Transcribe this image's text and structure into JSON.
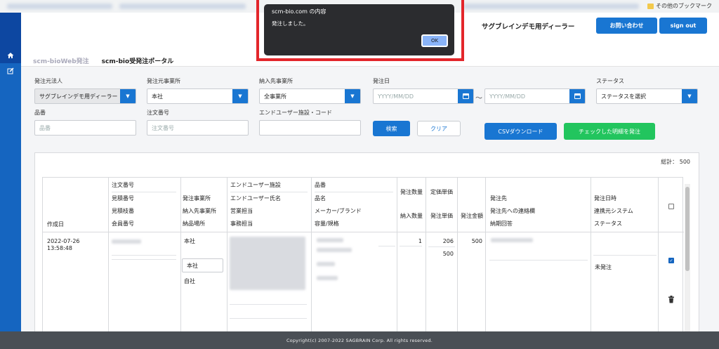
{
  "browser": {
    "bookmark_label": "その他のブックマーク"
  },
  "header": {
    "dealer_name": "サグブレインデモ用ディーラー",
    "contact_label": "お問い合わせ",
    "signout_label": "sign out"
  },
  "tabs": [
    "scm-bioWeb発注",
    "scm-bio受発注ポータル"
  ],
  "filters": {
    "hatchu_moto_hojin": {
      "label": "発注元法人",
      "value": "サグブレインデモ用ディーラー"
    },
    "hatchu_moto_jigyosho": {
      "label": "発注元事業所",
      "value": "本社"
    },
    "nonyu_saki_jigyosho": {
      "label": "納入先事業所",
      "value": "全事業所"
    },
    "hatchu_bi": {
      "label": "発注日",
      "from_placeholder": "YYYY/MM/DD",
      "to_placeholder": "YYYY/MM/DD",
      "separator": "〜"
    },
    "status": {
      "label": "ステータス",
      "value": "ステータスを選択"
    },
    "hinban": {
      "label": "品番",
      "placeholder": "品番"
    },
    "chumon_bango": {
      "label": "注文番号",
      "placeholder": "注文番号"
    },
    "end_user": {
      "label": "エンドユーザー施設・コード",
      "value": ""
    }
  },
  "actions": {
    "search": "検索",
    "clear": "クリア",
    "csv": "CSVダウンロード",
    "order_checked": "チェックした明細を発注"
  },
  "table": {
    "total_label": "総計： 500",
    "headers": {
      "created": "作成日",
      "order_no": [
        "注文番号",
        "見積番号",
        "見積枝番",
        "会員番号"
      ],
      "office": [
        "発注事業所",
        "納入先事業所",
        "納品場所"
      ],
      "end_user": [
        "エンドユーザー施設",
        "エンドユーザー氏名",
        "営業担当",
        "事務担当"
      ],
      "product": [
        "品番",
        "品名",
        "メーカー/ブランド",
        "容量/規格"
      ],
      "qty": [
        "発注数量",
        "納入数量"
      ],
      "unit_price": [
        "定価単価",
        "発注単価"
      ],
      "amount": "発注金額",
      "supplier": [
        "発注先",
        "発注先への連絡欄",
        "納期回答"
      ],
      "order_info": [
        "発注日時",
        "連携元システム",
        "ステータス"
      ]
    },
    "row": {
      "created": "2022-07-26\n13:58:48",
      "office": "本社",
      "delivery_office": "本社",
      "delivery_place": "自社",
      "qty": "1",
      "list_price": "206",
      "unit_price": "500",
      "amount": "500",
      "status": "未発注"
    }
  },
  "footer": {
    "copyright": "Copyright(c) 2007-2022 SAGBRAIN Corp. All rights reserved."
  },
  "alert": {
    "title": "scm-bio.com の内容",
    "message": "発注しました。",
    "ok_label": "OK"
  },
  "colors": {
    "primary": "#1976d2",
    "sidebar": "#1565c0",
    "success": "#22c55e",
    "highlight": "#e3262b",
    "dialog": "#2b2c2f"
  }
}
